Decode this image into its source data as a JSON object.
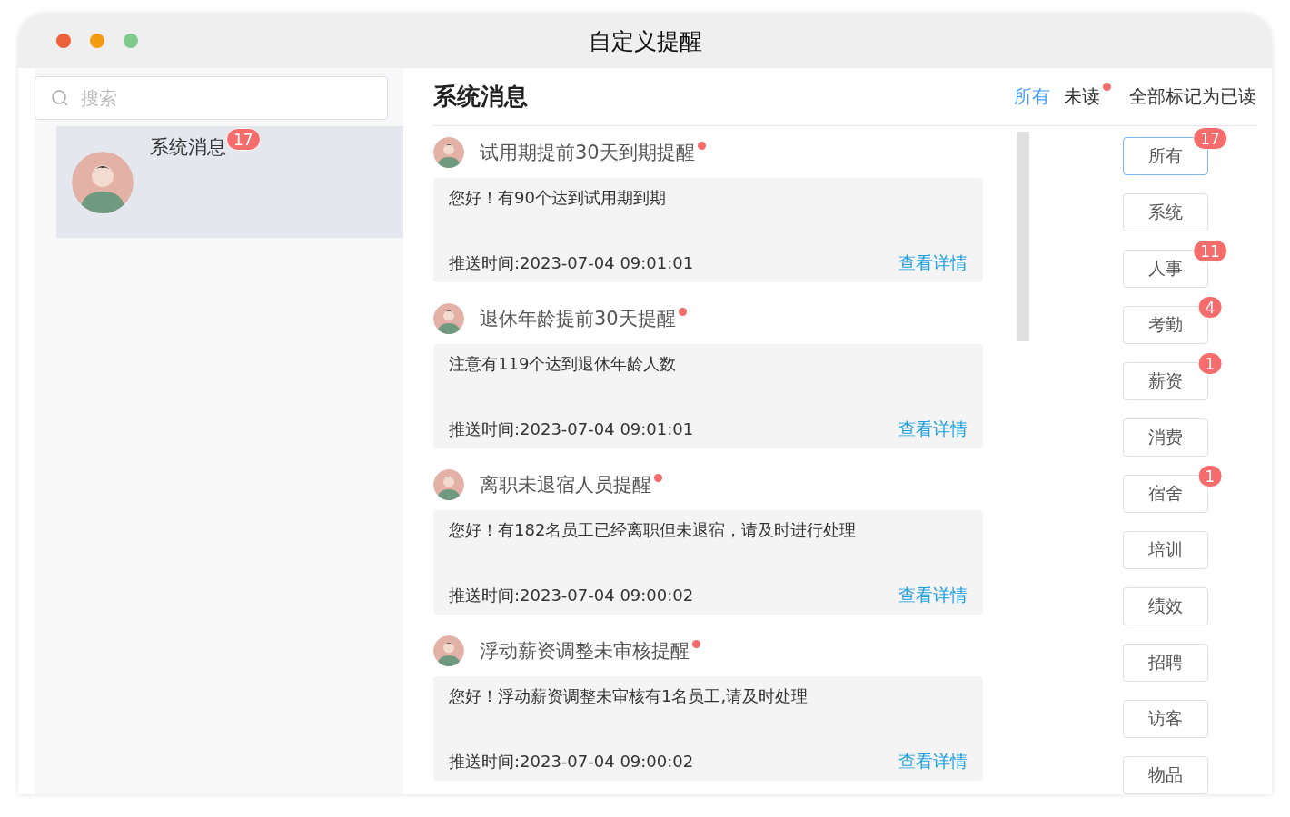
{
  "window": {
    "title": "自定义提醒"
  },
  "search": {
    "placeholder": "搜索"
  },
  "conversations": [
    {
      "name": "系统消息",
      "badge": "17",
      "selected": true
    }
  ],
  "header": {
    "title": "系统消息",
    "filters": [
      {
        "label": "所有",
        "selected": true,
        "dot": false
      },
      {
        "label": "未读",
        "selected": false,
        "dot": true
      }
    ],
    "mark_all": "全部标记为已读"
  },
  "messages": [
    {
      "title": "试用期提前30天到期提醒",
      "unread": true,
      "content": "您好！有90个达到试用期到期",
      "time": "推送时间:2023-07-04 09:01:01",
      "link": "查看详情"
    },
    {
      "title": "退休年龄提前30天提醒",
      "unread": true,
      "content": "注意有119个达到退休年龄人数",
      "time": "推送时间:2023-07-04 09:01:01",
      "link": "查看详情"
    },
    {
      "title": "离职未退宿人员提醒",
      "unread": true,
      "content": "您好！有182名员工已经离职但未退宿，请及时进行处理",
      "time": "推送时间:2023-07-04 09:00:02",
      "link": "查看详情"
    },
    {
      "title": "浮动薪资调整未审核提醒",
      "unread": true,
      "content": "您好！浮动薪资调整未审核有1名员工,请及时处理",
      "time": "推送时间:2023-07-04 09:00:02",
      "link": "查看详情"
    }
  ],
  "categories": [
    {
      "label": "所有",
      "badge": "17",
      "selected": true
    },
    {
      "label": "系统",
      "selected": false
    },
    {
      "label": "人事",
      "badge": "11",
      "selected": false
    },
    {
      "label": "考勤",
      "badge": "4",
      "selected": false
    },
    {
      "label": "薪资",
      "badge": "1",
      "selected": false
    },
    {
      "label": "消费",
      "selected": false
    },
    {
      "label": "宿舍",
      "badge": "1",
      "selected": false
    },
    {
      "label": "培训",
      "selected": false
    },
    {
      "label": "绩效",
      "selected": false
    },
    {
      "label": "招聘",
      "selected": false
    },
    {
      "label": "访客",
      "selected": false
    },
    {
      "label": "物品",
      "selected": false
    }
  ]
}
